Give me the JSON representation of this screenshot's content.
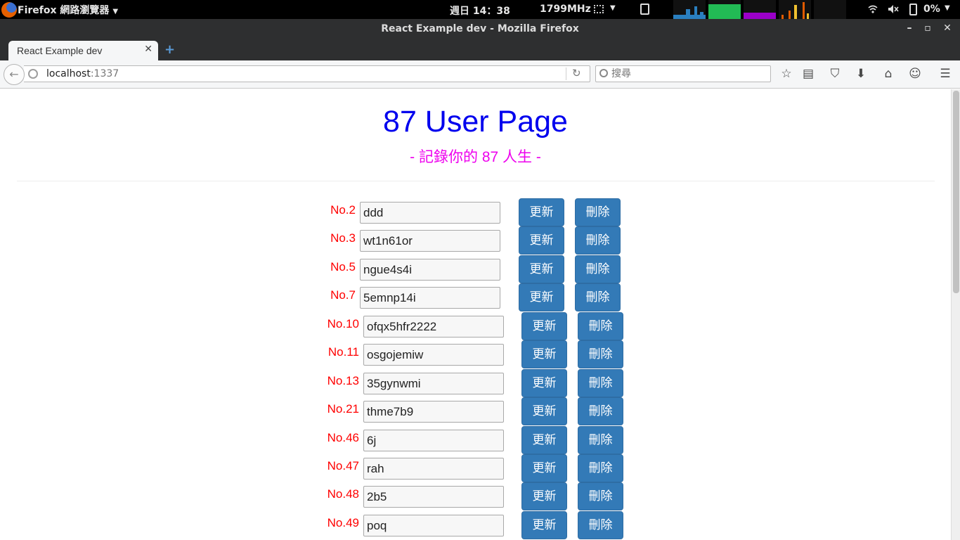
{
  "system_panel": {
    "app_menu_label": "Firefox 網路瀏覽器",
    "clock": "週日 14：38",
    "cpu_freq": "1799MHz",
    "battery_percent": "0%"
  },
  "window": {
    "title": "React Example dev - Mozilla Firefox"
  },
  "tab": {
    "title": "React Example dev"
  },
  "navbar": {
    "url_host": "localhost",
    "url_port": ":1337",
    "search_placeholder": "搜尋"
  },
  "page": {
    "title": "87 User Page",
    "subtitle": "- 記錄你的 87 人生 -",
    "update_label": "更新",
    "delete_label": "刪除",
    "users": [
      {
        "label": "No.2",
        "name": "ddd"
      },
      {
        "label": "No.3",
        "name": "wt1n61or"
      },
      {
        "label": "No.5",
        "name": "ngue4s4i"
      },
      {
        "label": "No.7",
        "name": "5emnp14i"
      },
      {
        "label": "No.10",
        "name": "ofqx5hfr2222"
      },
      {
        "label": "No.11",
        "name": "osgojemiw"
      },
      {
        "label": "No.13",
        "name": "35gynwmi"
      },
      {
        "label": "No.21",
        "name": "thme7b9"
      },
      {
        "label": "No.46",
        "name": "6j"
      },
      {
        "label": "No.47",
        "name": "rah"
      },
      {
        "label": "No.48",
        "name": "2b5"
      },
      {
        "label": "No.49",
        "name": "poq"
      }
    ]
  },
  "colors": {
    "title": "#0000ee",
    "subtitle": "#ee00ee",
    "number_label": "#ff0000",
    "button_bg": "#337ab7"
  }
}
